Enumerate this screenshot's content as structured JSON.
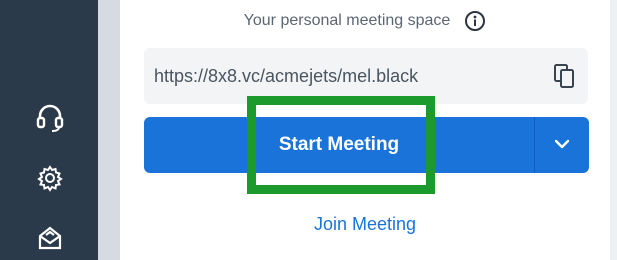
{
  "sidebar": {
    "icons": [
      "headset-icon",
      "gear-icon",
      "box-icon"
    ]
  },
  "meeting": {
    "space_label": "Your personal meeting space",
    "url": "https://8x8.vc/acmejets/mel.black",
    "start_label": "Start Meeting",
    "join_label": "Join Meeting"
  },
  "colors": {
    "sidebar_bg": "#2b3a4a",
    "accent_blue": "#1a73d9",
    "highlight_green": "#1c9a2c"
  }
}
